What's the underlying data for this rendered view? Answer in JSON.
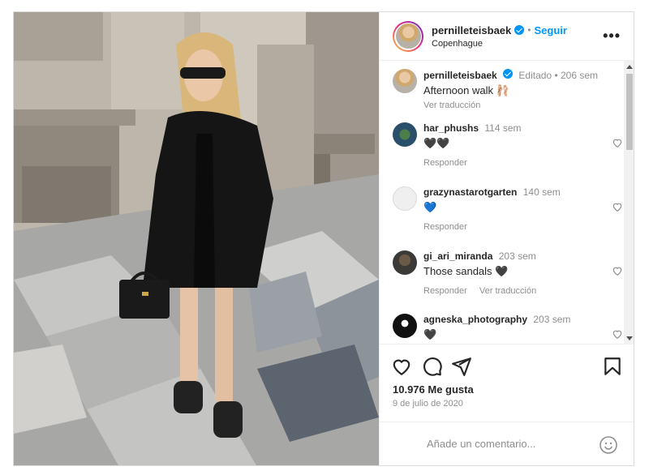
{
  "post": {
    "username": "pernilleteisbaek",
    "separator": "•",
    "follow_label": "Seguir",
    "location": "Copenhague",
    "more_label": "•••"
  },
  "caption": {
    "username": "pernilleteisbaek",
    "meta": "Editado • 206 sem",
    "text": "Afternoon walk 🩰",
    "translate_label": "Ver traducción"
  },
  "comments": [
    {
      "username": "har_phushs",
      "time": "114 sem",
      "text": "🖤🖤",
      "reply_label": "Responder",
      "translate_label": ""
    },
    {
      "username": "grazynastarotgarten",
      "time": "140 sem",
      "text": "💙",
      "reply_label": "Responder",
      "translate_label": ""
    },
    {
      "username": "gi_ari_miranda",
      "time": "203 sem",
      "text": "Those sandals 🖤",
      "reply_label": "Responder",
      "translate_label": "Ver traducción"
    },
    {
      "username": "agneska_photography",
      "time": "203 sem",
      "text": "🖤",
      "reply_label": "",
      "translate_label": ""
    }
  ],
  "likes": "10.976 Me gusta",
  "date": "9 de julio de 2020",
  "add_comment_placeholder": "Añade un comentario...",
  "icons": {
    "like": "heart-icon",
    "comment": "comment-icon",
    "share": "share-icon",
    "save": "bookmark-icon",
    "emoji": "emoji-icon",
    "more": "more-icon",
    "verified": "verified-icon"
  },
  "colors": {
    "accent": "#0095f6",
    "muted": "#8e8e8e",
    "text": "#262626",
    "border": "#dbdbdb"
  }
}
